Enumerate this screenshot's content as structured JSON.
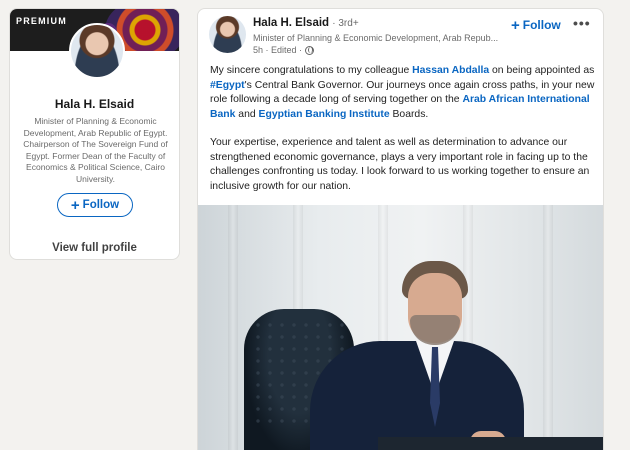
{
  "sidebar": {
    "premium_label": "PREMIUM",
    "name": "Hala H. Elsaid",
    "headline": "Minister of Planning & Economic Development, Arab Republic of Egypt. Chairperson of The Sovereign Fund of Egypt. Former Dean of the Faculty of Economics & Political Science, Cairo University.",
    "follow_label": "Follow",
    "view_profile_label": "View full profile"
  },
  "post": {
    "author_name": "Hala H. Elsaid",
    "degree": "· 3rd+",
    "author_subtitle": "Minister of Planning & Economic Development, Arab Repub...",
    "meta": "5h · Edited ·",
    "follow_label": "Follow",
    "more_label": "•••",
    "text": {
      "p1_a": "My sincere congratulations to my colleague ",
      "p1_link1": "Hassan Abdalla",
      "p1_b": " on being appointed as ",
      "p1_hashtag": "#Egypt",
      "p1_c": "'s Central Bank Governor. Our journeys once again cross paths, in your new role following a decade long of serving together on the ",
      "p1_link2": "Arab African International Bank",
      "p1_d": " and ",
      "p1_link3": "Egyptian Banking Institute",
      "p1_e": " Boards.",
      "p2": "Your expertise, experience and talent as well as determination to advance our strengthened economic governance, plays a very important role in facing up to the challenges confronting us today. I look forward to us working together to ensure an inclusive growth for our nation."
    }
  },
  "colors": {
    "accent": "#0a66c2",
    "background": "#f3f2ef",
    "card": "#ffffff"
  }
}
